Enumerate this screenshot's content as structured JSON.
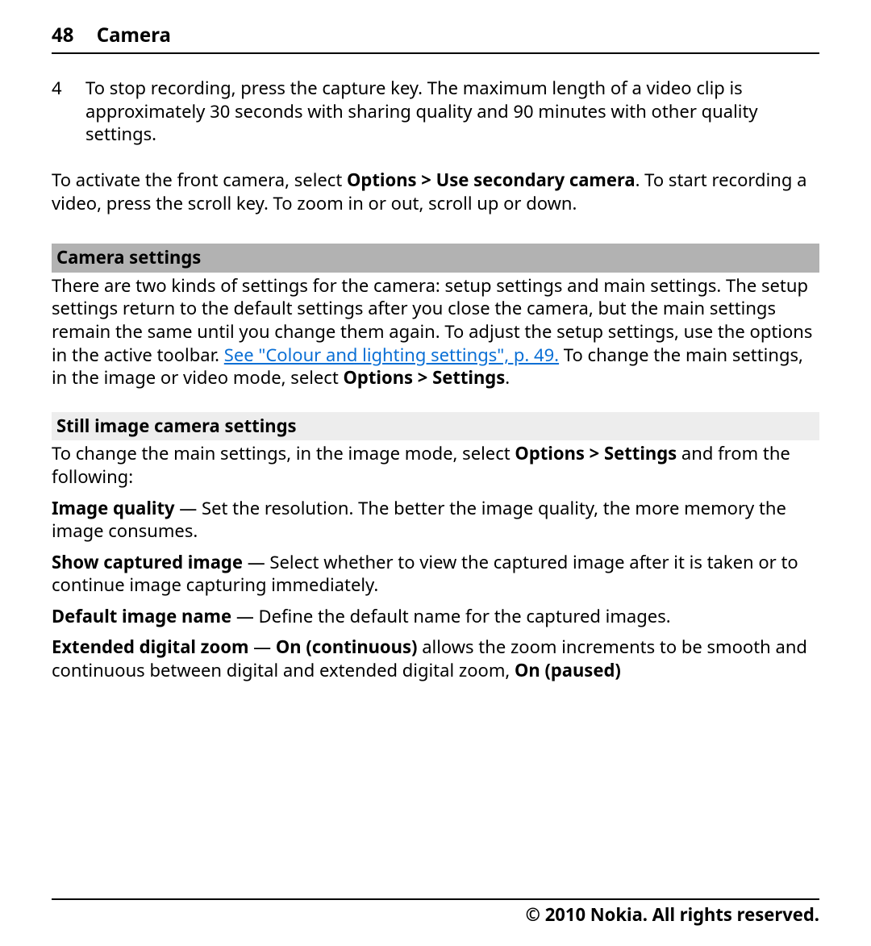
{
  "header": {
    "page_number": "48",
    "chapter": "Camera"
  },
  "step4": {
    "marker": "4",
    "text": "To stop recording, press the capture key. The maximum length of a video clip is approximately 30 seconds with sharing quality and 90 minutes with other quality settings."
  },
  "front_camera": {
    "lead": "To activate the front camera, select ",
    "menu": "Options  > Use secondary camera",
    "tail": ". To start recording a video, press the scroll key. To zoom in or out, scroll up or down."
  },
  "camera_settings": {
    "heading": "Camera settings",
    "p1": "There are two kinds of settings for the camera: setup settings and main settings. The setup settings return to the default settings after you close the camera, but the main settings remain the same until you change them again. To adjust the setup settings, use the options in the active toolbar. ",
    "link_text": "See \"Colour and lighting settings\", p. 49.",
    "p2_lead": " To change the main settings, in the image or video mode, select ",
    "p2_menu": "Options  > Settings",
    "p2_tail": "."
  },
  "still": {
    "heading": "Still image camera settings",
    "intro_lead": "To change the main settings, in the image mode, select ",
    "intro_menu": "Options  > Settings",
    "intro_tail": " and from the following:",
    "defs": {
      "imgq_term": "Image quality ",
      "imgq_desc": " — Set the resolution. The better the image quality, the more memory the image consumes.",
      "show_term": "Show captured image ",
      "show_desc": " — Select whether to view the captured image after it is taken or to continue image capturing immediately.",
      "name_term": "Default image name ",
      "name_desc": " — Define the default name for the captured images.",
      "zoom_term": "Extended digital zoom ",
      "zoom_sep": " — ",
      "zoom_opt1": "On (continuous)",
      "zoom_mid": " allows the zoom increments to be smooth and continuous between digital and extended digital zoom, ",
      "zoom_opt2": "On (paused)"
    }
  },
  "footer": {
    "copyright": "© 2010 Nokia. All rights reserved."
  }
}
